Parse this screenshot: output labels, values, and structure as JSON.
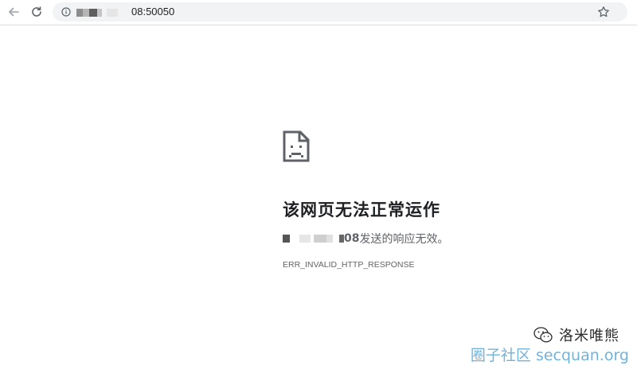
{
  "toolbar": {
    "back_icon": "arrow-left-icon",
    "reload_icon": "reload-icon",
    "star_icon": "star-icon",
    "info_icon": "info-icon",
    "url_suffix": "08:50050"
  },
  "error": {
    "icon": "sad-document-icon",
    "title": "该网页无法正常运作",
    "message_host_suffix": "08",
    "message_tail": " 发送的响应无效。",
    "code": "ERR_INVALID_HTTP_RESPONSE"
  },
  "watermark": {
    "name": "洛米唯熊",
    "site": "圈子社区 secquan.org"
  },
  "colors": {
    "text_primary": "#202124",
    "text_secondary": "#5f6368",
    "omnibox_bg": "#f1f3f4",
    "watermark_blue": "#58a6d8"
  }
}
